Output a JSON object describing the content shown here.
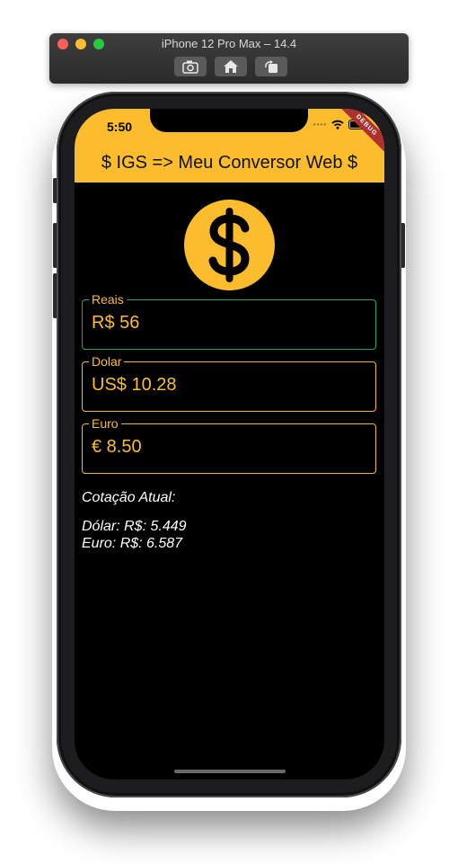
{
  "simulator": {
    "title": "iPhone 12 Pro Max – 14.4"
  },
  "status_bar": {
    "time": "5:50",
    "debug_banner": "DEBUG"
  },
  "app_bar": {
    "title": "$ IGS => Meu Conversor Web $"
  },
  "fields": {
    "reais": {
      "label": "Reais",
      "value": "R$ 56"
    },
    "dolar": {
      "label": "Dolar",
      "value": "US$ 10.28"
    },
    "euro": {
      "label": "Euro",
      "value": "€ 8.50"
    }
  },
  "quote": {
    "heading": "Cotação Atual:",
    "dolar": "Dólar: R$: 5.449",
    "euro": "Euro: R$: 6.587"
  },
  "colors": {
    "accent": "#fbbd2e",
    "focused_border": "#2aa64a",
    "background": "#000000"
  },
  "icons": {
    "header_coin": "dollar-coin-icon",
    "screenshot_button": "camera-icon",
    "home_button": "home-icon",
    "rotate_button": "rotate-icon"
  }
}
